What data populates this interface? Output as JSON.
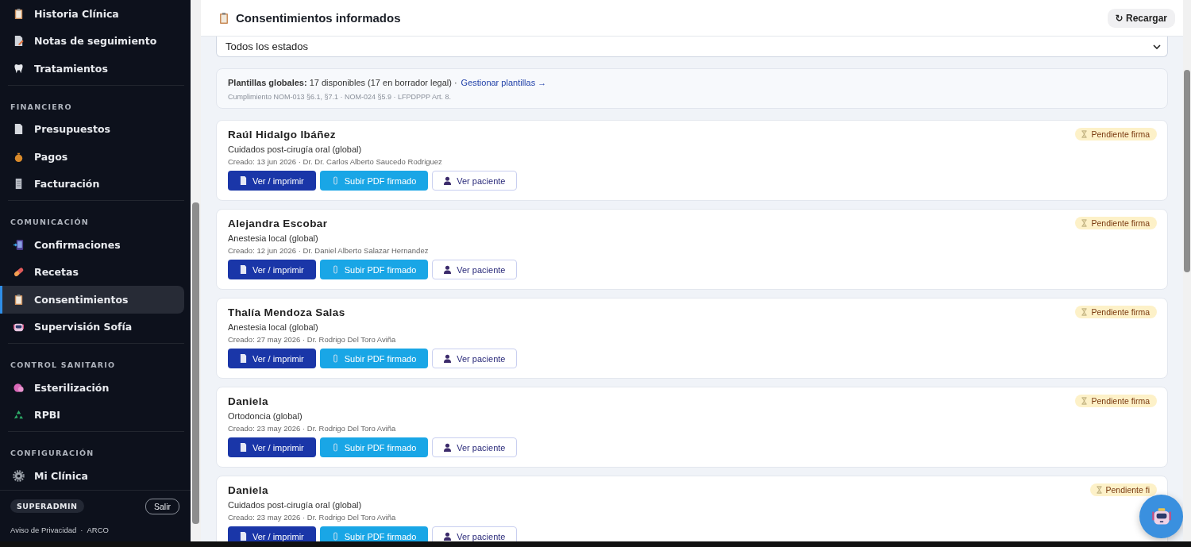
{
  "sidebar": {
    "sections": [
      {
        "items": [
          {
            "label": "Historia Clínica",
            "selected": false
          },
          {
            "label": "Notas de seguimiento",
            "selected": false
          },
          {
            "label": "Tratamientos",
            "selected": false
          }
        ]
      },
      {
        "title": "FINANCIERO",
        "items": [
          {
            "label": "Presupuestos",
            "selected": false
          },
          {
            "label": "Pagos",
            "selected": false
          },
          {
            "label": "Facturación",
            "selected": false
          }
        ]
      },
      {
        "title": "COMUNICACIÓN",
        "items": [
          {
            "label": "Confirmaciones",
            "selected": false
          },
          {
            "label": "Recetas",
            "selected": false
          },
          {
            "label": "Consentimientos",
            "selected": true
          },
          {
            "label": "Supervisión Sofía",
            "selected": false
          }
        ]
      },
      {
        "title": "CONTROL SANITARIO",
        "items": [
          {
            "label": "Esterilización",
            "selected": false
          },
          {
            "label": "RPBI",
            "selected": false
          }
        ]
      },
      {
        "title": "CONFIGURACIÓN",
        "items": [
          {
            "label": "Mi Clínica",
            "selected": false
          }
        ]
      }
    ],
    "role_badge": "SUPERADMIN",
    "logout_button": "Salir",
    "footer_links": [
      "Aviso de Privacidad",
      "ARCO"
    ],
    "footer_separator": "·"
  },
  "header": {
    "title": "Consentimientos informados",
    "reload_button": "↻ Recargar"
  },
  "filter": {
    "value": "Todos los estados"
  },
  "templates": {
    "label": "Plantillas globales:",
    "text": "17 disponibles (17 en borrador legal) ·",
    "link": "Gestionar plantillas →",
    "note": "Cumplimiento NOM-013 §6.1, §7.1 · NOM-024 §5.9 · LFPDPPP Art. 8."
  },
  "consents": [
    {
      "patient": "Raúl Hidalgo Ibáñez",
      "template": "Cuidados post-cirugía oral (global)",
      "meta": "Creado: 13 jun 2026 · Dr. Dr. Carlos Alberto Saucedo Rodriguez",
      "status": {
        "label": "Pendiente firma",
        "kind": "pending"
      },
      "buttons": [
        {
          "label": "Ver / imprimir",
          "kind": "primary"
        },
        {
          "label": "Subir PDF firmado",
          "kind": "info"
        },
        {
          "label": "Ver paciente",
          "kind": "outline"
        }
      ]
    },
    {
      "patient": "Alejandra Escobar",
      "template": "Anestesia local (global)",
      "meta": "Creado: 12 jun 2026 · Dr. Daniel Alberto Salazar Hernandez",
      "status": {
        "label": "Pendiente firma",
        "kind": "pending"
      },
      "buttons": [
        {
          "label": "Ver / imprimir",
          "kind": "primary"
        },
        {
          "label": "Subir PDF firmado",
          "kind": "info"
        },
        {
          "label": "Ver paciente",
          "kind": "outline"
        }
      ]
    },
    {
      "patient": "Thalía Mendoza Salas",
      "template": "Anestesia local (global)",
      "meta": "Creado: 27 may 2026 · Dr. Rodrigo Del Toro Aviña",
      "status": {
        "label": "Pendiente firma",
        "kind": "pending"
      },
      "buttons": [
        {
          "label": "Ver / imprimir",
          "kind": "primary"
        },
        {
          "label": "Subir PDF firmado",
          "kind": "info"
        },
        {
          "label": "Ver paciente",
          "kind": "outline"
        }
      ]
    },
    {
      "patient": "Daniela",
      "template": "Ortodoncia (global)",
      "meta": "Creado: 23 may 2026 · Dr. Rodrigo Del Toro Aviña",
      "status": {
        "label": "Pendiente firma",
        "kind": "pending"
      },
      "buttons": [
        {
          "label": "Ver / imprimir",
          "kind": "primary"
        },
        {
          "label": "Subir PDF firmado",
          "kind": "info"
        },
        {
          "label": "Ver paciente",
          "kind": "outline"
        }
      ]
    },
    {
      "patient": "Daniela",
      "template": "Cuidados post-cirugía oral (global)",
      "meta": "Creado: 23 may 2026 · Dr. Rodrigo Del Toro Aviña",
      "status": {
        "label": "Pendiente fi",
        "kind": "pending"
      },
      "buttons": [
        {
          "label": "Ver / imprimir",
          "kind": "primary"
        },
        {
          "label": "Subir PDF firmado",
          "kind": "info"
        },
        {
          "label": "Ver paciente",
          "kind": "outline"
        }
      ]
    }
  ]
}
